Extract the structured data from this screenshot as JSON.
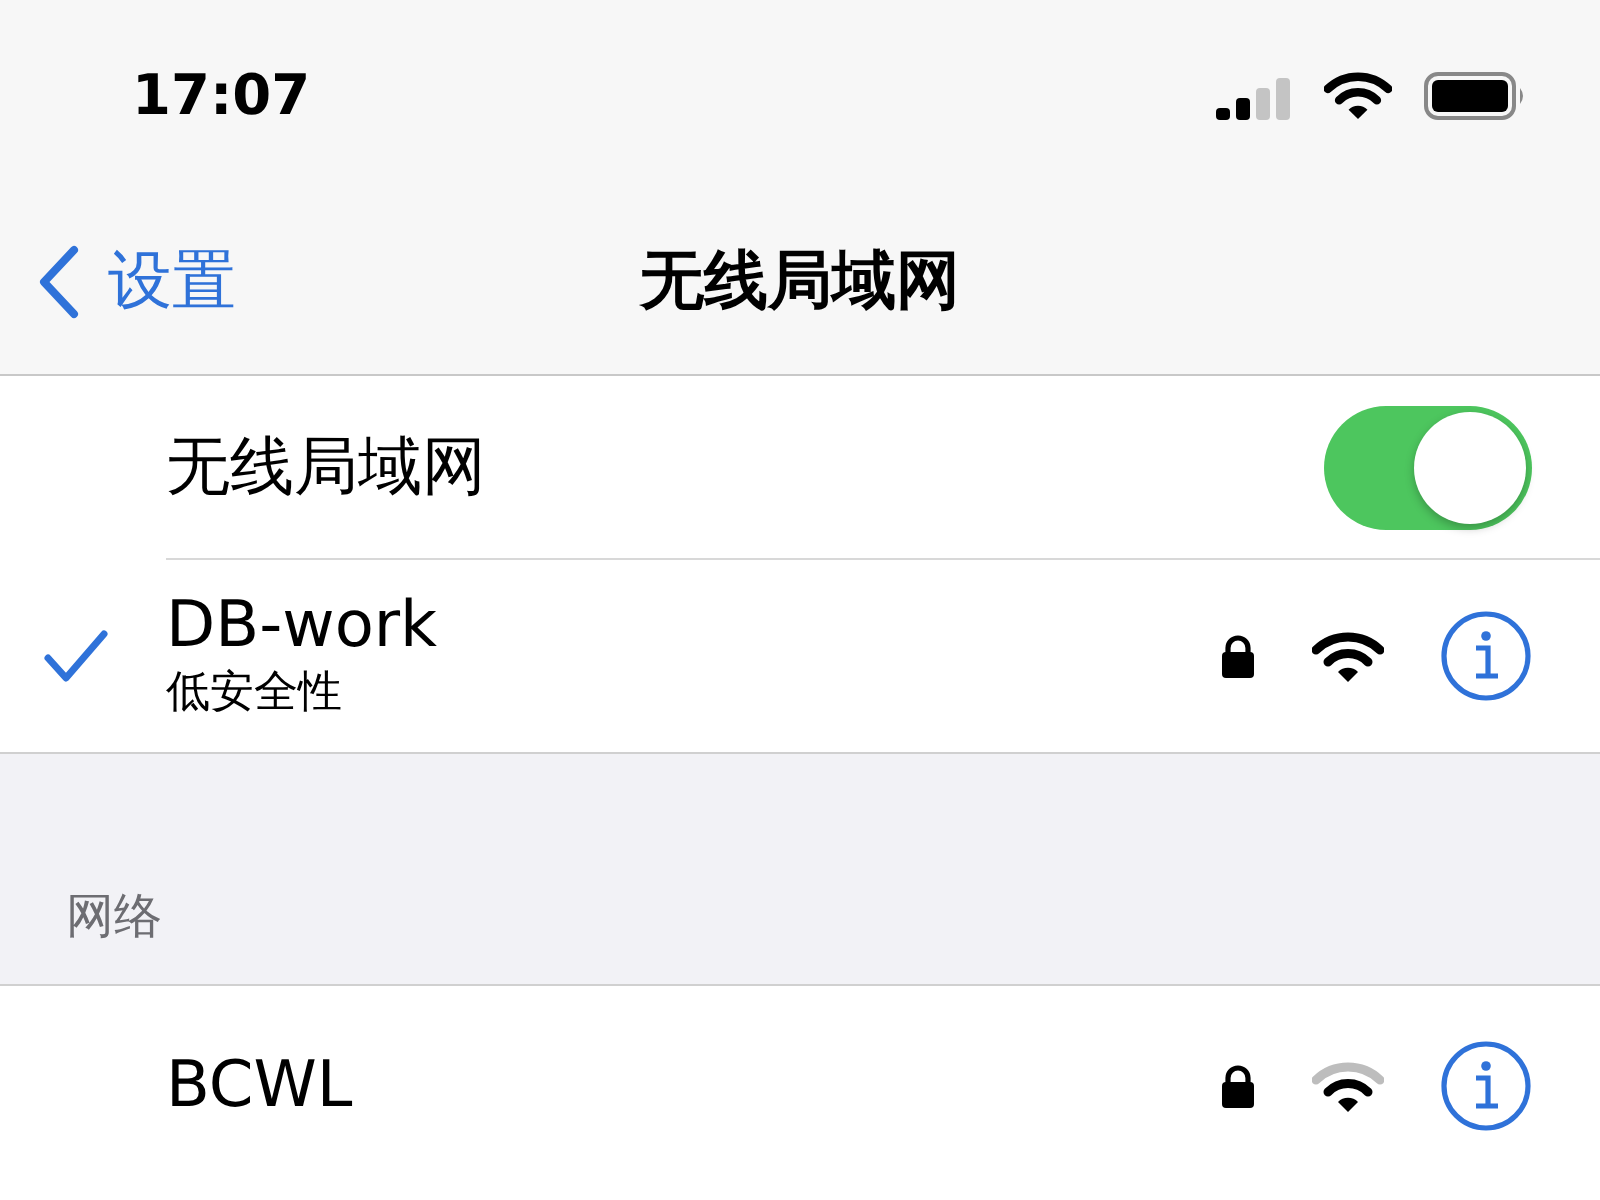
{
  "status_bar": {
    "time": "17:07"
  },
  "nav": {
    "back": "设置",
    "title": "无线局域网"
  },
  "wifi_toggle": {
    "label": "无线局域网",
    "on": true
  },
  "current_network": {
    "name": "DB-work",
    "subtitle": "低安全性",
    "selected": true,
    "locked": true,
    "signal_full": true
  },
  "section_header": "网络",
  "networks": [
    {
      "name": "BCWL",
      "locked": true,
      "signal_full": false
    }
  ]
}
